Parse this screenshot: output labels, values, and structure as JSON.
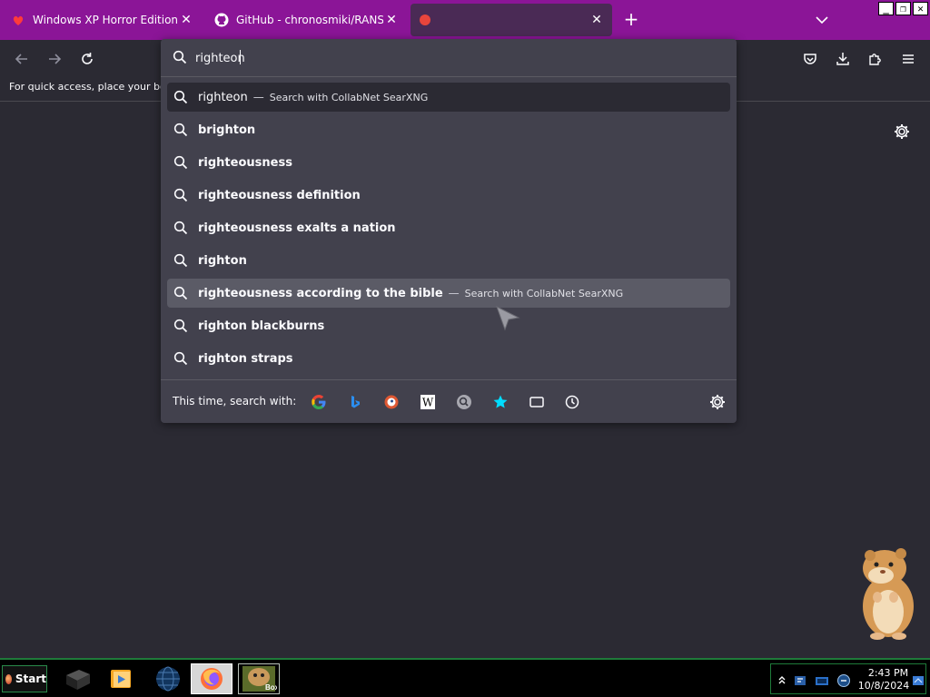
{
  "tabs": [
    {
      "title": "Windows XP Horror Edition | Spinp",
      "close": "✕"
    },
    {
      "title": "GitHub - chronosmiki/RANSOMWA",
      "close": "✕"
    },
    {
      "title": "",
      "close": "✕"
    }
  ],
  "tabstrip": {
    "new_tab": "+"
  },
  "window_controls": {
    "minimize": "_",
    "maximize": "❐",
    "close": "✕"
  },
  "bookmarks_bar": {
    "hint": "For quick access, place your bookm"
  },
  "url_bar": {
    "value": "righteon"
  },
  "suggestions": [
    {
      "text": "righteon",
      "separator": "—",
      "action": "Search with CollabNet SearXNG"
    },
    {
      "text": "brighton"
    },
    {
      "text": "righteousness"
    },
    {
      "text": "righteousness definition"
    },
    {
      "text": "righteousness exalts a nation"
    },
    {
      "text": "righton"
    },
    {
      "text": "righteousness according to the bible",
      "separator": "—",
      "action": "Search with CollabNet SearXNG"
    },
    {
      "text": "righton blackburns"
    },
    {
      "text": "righton straps"
    }
  ],
  "one_off": {
    "label": "This time, search with:",
    "engines": [
      "google-icon",
      "bing-icon",
      "duckduckgo-icon",
      "wikipedia-icon",
      "searxng-icon",
      "bookmarks-icon",
      "tabs-icon",
      "history-icon"
    ],
    "wikipedia_letter": "W"
  },
  "taskbar": {
    "start_label": "Start",
    "clock_time": "2:43 PM",
    "clock_date": "10/8/2024",
    "box_label": "Box"
  },
  "colors": {
    "tabstrip": "#8b1597",
    "toolbar": "#2b2a33",
    "dropdown": "#42414d",
    "highlight": "#5b5b66",
    "taskbar_accent": "#1f7a3a"
  }
}
